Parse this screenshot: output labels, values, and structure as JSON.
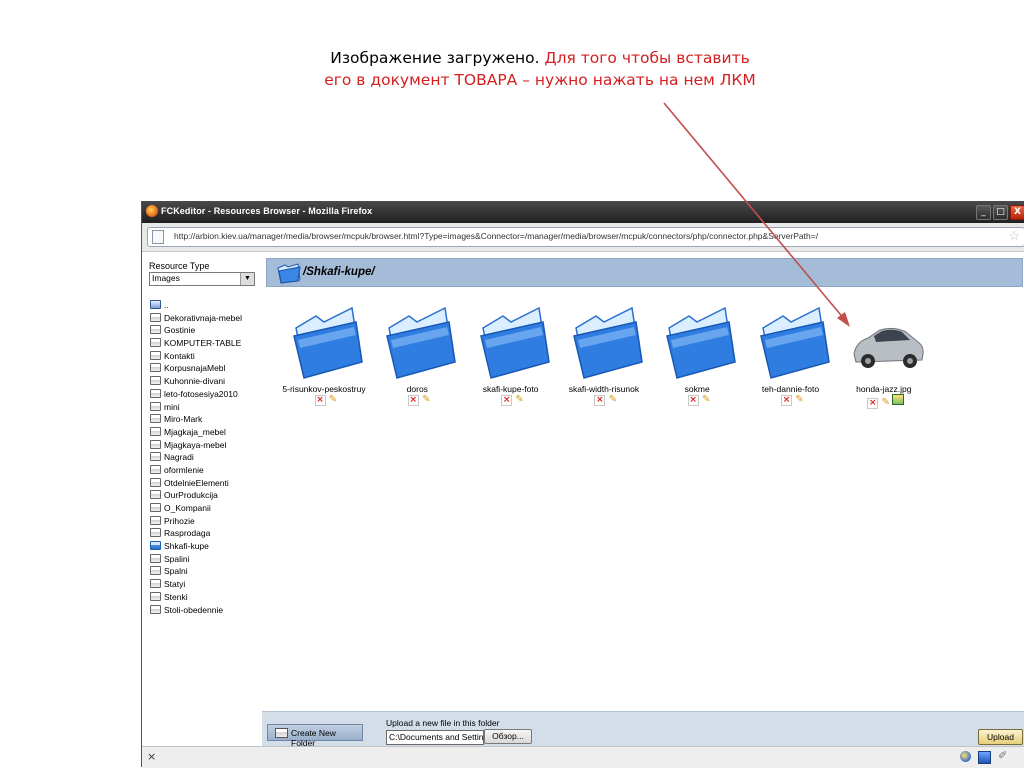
{
  "caption": {
    "line1_black": "Изображение загружено.",
    "line1_red": "Для того чтобы вставить",
    "line2_red": "его в документ ТОВАРА – нужно нажать на нем ЛКМ"
  },
  "window": {
    "title": "FCKeditor - Resources Browser - Mozilla Firefox",
    "min_label": "_",
    "max_label": "□",
    "close_label": "X",
    "url": "http://arbion.kiev.ua/manager/media/browser/mcpuk/browser.html?Type=images&Connector=/manager/media/browser/mcpuk/connectors/php/connector.php&ServerPath=/"
  },
  "resource_type": {
    "label": "Resource Type",
    "selected": "Images"
  },
  "tree": {
    "items": [
      {
        "label": "..",
        "kind": "up"
      },
      {
        "label": "Dekorativnaja-mebel",
        "kind": "folder"
      },
      {
        "label": "Gostinie",
        "kind": "folder"
      },
      {
        "label": "KOMPUTER-TABLE",
        "kind": "folder"
      },
      {
        "label": "Kontakti",
        "kind": "folder"
      },
      {
        "label": "KorpusnajaMebl",
        "kind": "folder"
      },
      {
        "label": "Kuhonnie-divani",
        "kind": "folder"
      },
      {
        "label": "leto-fotosesiya2010",
        "kind": "folder"
      },
      {
        "label": "mini",
        "kind": "folder"
      },
      {
        "label": "Miro-Mark",
        "kind": "folder"
      },
      {
        "label": "Mjagkaja_mebel",
        "kind": "folder"
      },
      {
        "label": "Mjagkaya-mebel",
        "kind": "folder"
      },
      {
        "label": "Nagradi",
        "kind": "folder"
      },
      {
        "label": "oformlenie",
        "kind": "folder"
      },
      {
        "label": "OtdelnieElementi",
        "kind": "folder"
      },
      {
        "label": "OurProdukcija",
        "kind": "folder"
      },
      {
        "label": "O_Kompanii",
        "kind": "folder"
      },
      {
        "label": "Prihozie",
        "kind": "folder"
      },
      {
        "label": "Rasprodaga",
        "kind": "folder"
      },
      {
        "label": "Shkafi-kupe",
        "kind": "selected"
      },
      {
        "label": "Spalini",
        "kind": "folder"
      },
      {
        "label": "Spalni",
        "kind": "folder"
      },
      {
        "label": "Statyi",
        "kind": "folder"
      },
      {
        "label": "Stenki",
        "kind": "folder"
      },
      {
        "label": "Stoli-obedennie",
        "kind": "folder"
      }
    ]
  },
  "current_path": "/Shkafi-kupe/",
  "files": [
    {
      "name": "5-risunkov-peskostruy",
      "type": "folder"
    },
    {
      "name": "doros",
      "type": "folder"
    },
    {
      "name": "skafi-kupe-foto",
      "type": "folder"
    },
    {
      "name": "skafi-width-risunok",
      "type": "folder"
    },
    {
      "name": "sokme",
      "type": "folder"
    },
    {
      "name": "teh-dannie-foto",
      "type": "folder"
    },
    {
      "name": "honda-jazz.jpg",
      "type": "image"
    }
  ],
  "action_icons": {
    "delete": "×",
    "rename": "✎"
  },
  "bottom": {
    "create_folder_label": "Create New Folder",
    "upload_label": "Upload a new file in this folder",
    "file_value": "C:\\Documents and Settings",
    "browse_label": "Обзор...",
    "upload_button": "Upload"
  },
  "status": {
    "close_glyph": "×",
    "addon_glyph": "✐"
  },
  "colors": {
    "caption_red": "#d42020",
    "arrow": "#c0504d",
    "pathbar": "#a4bcd8",
    "folder_blue": "#2f7de1"
  }
}
